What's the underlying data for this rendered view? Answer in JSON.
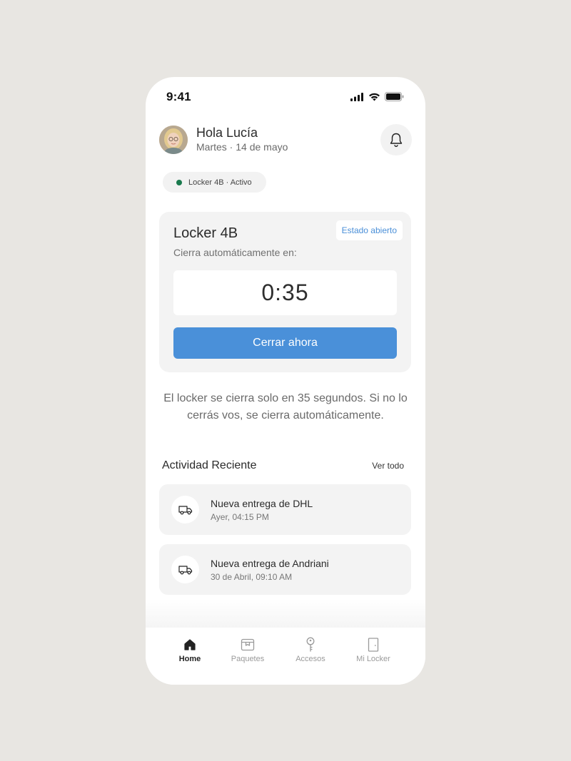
{
  "status_bar": {
    "time": "9:41"
  },
  "header": {
    "greeting": "Hola Lucía",
    "date": "Martes · 14 de mayo"
  },
  "locker_pill": {
    "label": "Locker 4B · Activo",
    "status_color": "#1a7a4e"
  },
  "locker_card": {
    "title": "Locker 4B",
    "state_badge": "Estado abierto",
    "auto_close_label": "Cierra automáticamente en:",
    "timer": "0:35",
    "close_button": "Cerrar ahora"
  },
  "info_text": "El locker se cierra solo en 35 segundos. Si no lo cerrás vos, se cierra automáticamente.",
  "activity": {
    "heading": "Actividad Reciente",
    "see_all": "Ver todo",
    "items": [
      {
        "title": "Nueva entrega de DHL",
        "time": "Ayer, 04:15 PM",
        "icon": "truck-icon"
      },
      {
        "title": "Nueva entrega de Andriani",
        "time": "30 de Abril, 09:10 AM",
        "icon": "truck-icon"
      }
    ]
  },
  "bottom_nav": {
    "items": [
      {
        "label": "Home",
        "icon": "home-icon",
        "active": true
      },
      {
        "label": "Paquetes",
        "icon": "package-icon",
        "active": false
      },
      {
        "label": "Accesos",
        "icon": "key-icon",
        "active": false
      },
      {
        "label": "Mi Locker",
        "icon": "door-icon",
        "active": false
      }
    ]
  },
  "colors": {
    "accent": "#4a90d9",
    "background": "#e8e6e2",
    "card": "#f3f3f3",
    "active_dot": "#1a7a4e"
  }
}
